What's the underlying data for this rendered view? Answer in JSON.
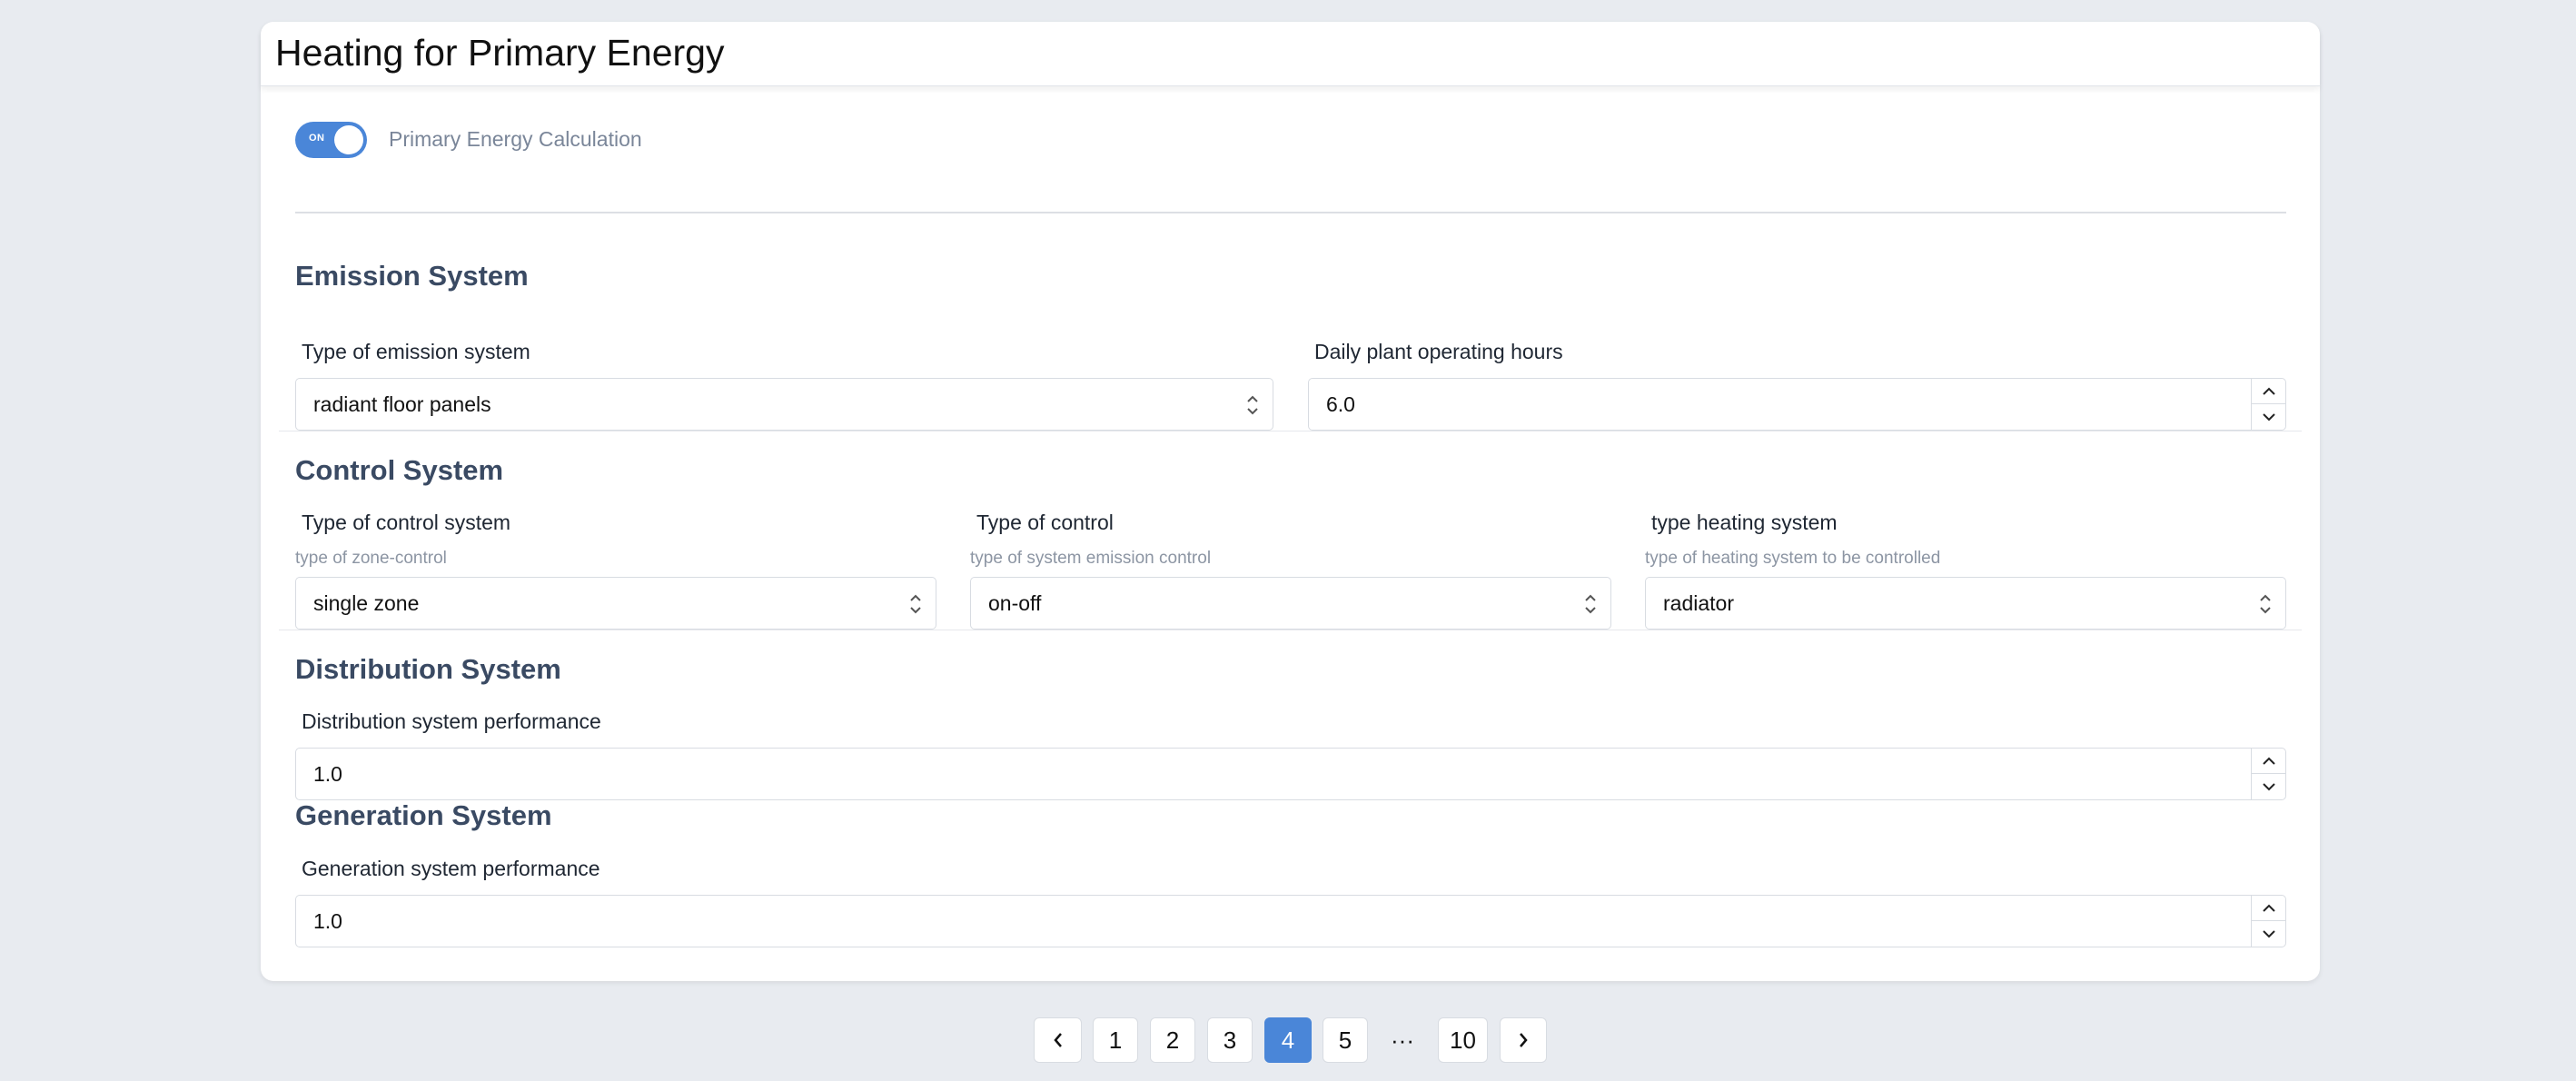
{
  "page": {
    "title": "Heating for Primary Energy"
  },
  "toggle": {
    "state_label": "ON",
    "label": "Primary Energy Calculation"
  },
  "emission": {
    "title": "Emission System",
    "type_label": "Type of emission system",
    "type_value": "radiant floor panels",
    "hours_label": "Daily plant operating hours",
    "hours_value": "6.0"
  },
  "control": {
    "title": "Control System",
    "system_label": "Type of control system",
    "system_hint": "type of zone-control",
    "system_value": "single zone",
    "type_label": "Type of control",
    "type_hint": "type of system emission control",
    "type_value": "on-off",
    "heating_label": "type heating system",
    "heating_hint": "type of heating system to be controlled",
    "heating_value": "radiator"
  },
  "distribution": {
    "title": "Distribution System",
    "perf_label": "Distribution system performance",
    "perf_value": "1.0"
  },
  "generation": {
    "title": "Generation System",
    "perf_label": "Generation system performance",
    "perf_value": "1.0"
  },
  "pagination": {
    "pages": [
      "1",
      "2",
      "3",
      "4",
      "5"
    ],
    "ellipsis": "···",
    "last": "10",
    "current": "4"
  },
  "colors": {
    "accent": "#4a86d8",
    "section_title": "#3a4a63"
  }
}
